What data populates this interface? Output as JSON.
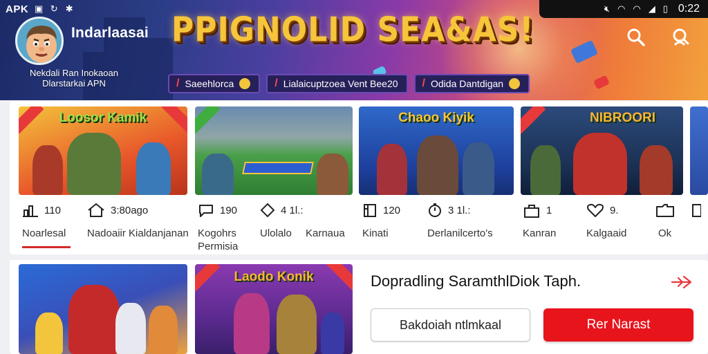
{
  "status_bar": {
    "left_label": "APK",
    "time": "0:22"
  },
  "header": {
    "app_title": "Indarlaasai",
    "app_subtitle_line1": "Nekdali Ran Inokaoan",
    "app_subtitle_line2": "Dlarstarkai APN",
    "banner": "PPIGNOLID SEA&AS!",
    "chips": [
      {
        "label": "Saeehlorca"
      },
      {
        "label": "Lialaicuptzoea Vent Bee20"
      },
      {
        "label": "Odida Dantdigan"
      }
    ]
  },
  "stats": [
    {
      "icon": "bar-chart-icon",
      "count": "110",
      "label": "Noarlesal"
    },
    {
      "icon": "home-icon",
      "count": "3:80ago",
      "label": "Nadoaiir Kialdanjanan"
    },
    {
      "icon": "comment-icon",
      "count": "190",
      "label": "Kogohrs\nPermisia"
    },
    {
      "icon": "diamond-icon",
      "count": "4  1l.:",
      "label": "Ulolalo"
    },
    {
      "icon": "",
      "count": "",
      "label": "Karnaua"
    },
    {
      "icon": "window-icon",
      "count": "120",
      "label": "Kinati"
    },
    {
      "icon": "timer-icon",
      "count": "3  1l.:",
      "label": "Derlanilcerto's"
    },
    {
      "icon": "bag-icon",
      "count": "1",
      "label": "Kanran"
    },
    {
      "icon": "heart-icon",
      "count": "9.",
      "label": "Kalgaaid"
    },
    {
      "icon": "folder-icon",
      "count": "",
      "label": "Ok"
    }
  ],
  "cards": [
    {
      "logo": "Loosor Kamik"
    },
    {
      "logo": ""
    },
    {
      "logo": "Chaoo Kiyik"
    },
    {
      "logo": "NIBROORI"
    },
    {
      "logo": ""
    },
    {
      "logo": "Laodo Konik"
    }
  ],
  "section": {
    "title": "Dopradling SaramthlDiok  Taph.",
    "secondary_button": "Bakdoiah ntlmkaal",
    "primary_button": "Rer Narast"
  },
  "colors": {
    "accent": "#e8141c",
    "chip_bg": "#26205a",
    "banner_text": "#f6c53a"
  }
}
